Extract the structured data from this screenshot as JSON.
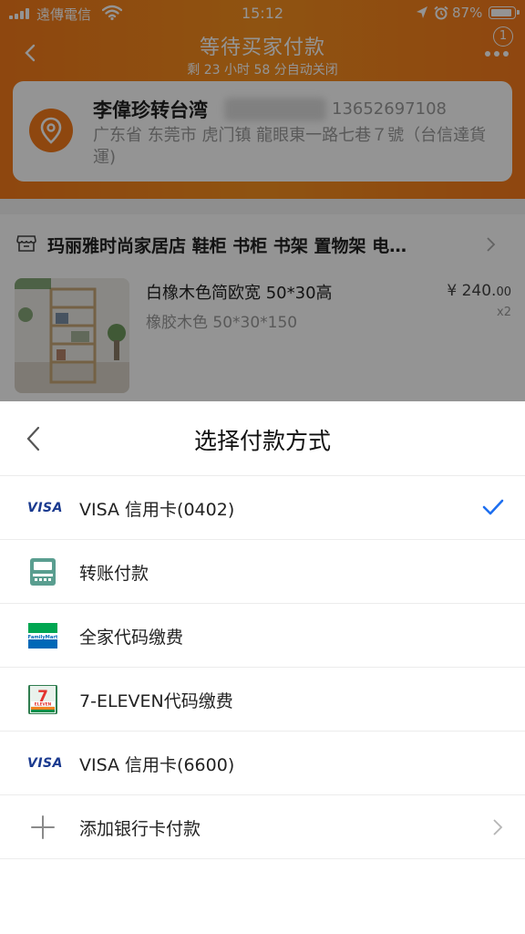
{
  "status_bar": {
    "carrier": "遠傳電信",
    "time": "15:12",
    "battery": "87%"
  },
  "header": {
    "title": "等待买家付款",
    "subtitle": "剩 23 小时 58 分自动关闭",
    "notification_count": "1"
  },
  "address": {
    "name": "李偉珍转台湾",
    "phone": "13652697108",
    "line": "广东省 东莞市 虎门镇 龍眼東一路七巷７號（台信達貨運)"
  },
  "store": {
    "name": "玛丽雅时尚家居店 鞋柜 书柜 书架 置物架 电…"
  },
  "product": {
    "title": "白橡木色简欧宽 50*30高",
    "spec": "橡胶木色 50*30*150",
    "price_main": "¥ 240.",
    "price_cents": "00",
    "quantity": "x2"
  },
  "payment_sheet": {
    "title": "选择付款方式",
    "methods": [
      {
        "label": "VISA 信用卡(0402)",
        "icon": "visa-icon",
        "selected": true
      },
      {
        "label": "转账付款",
        "icon": "atm-icon",
        "selected": false
      },
      {
        "label": "全家代码缴费",
        "icon": "familymart-icon",
        "selected": false
      },
      {
        "label": "7-ELEVEN代码缴费",
        "icon": "seven-eleven-icon",
        "selected": false
      },
      {
        "label": "VISA 信用卡(6600)",
        "icon": "visa-icon",
        "selected": false
      },
      {
        "label": "添加银行卡付款",
        "icon": "plus-icon",
        "selected": false
      }
    ],
    "visa_text": "VISA",
    "familymart_text": "FamilyMart",
    "seven_text": "ELEVEN",
    "seven_digit": "7"
  },
  "colors": {
    "header_orange": "#f47a1a",
    "check_blue": "#1e6ff0",
    "visa_blue": "#1a3a8f",
    "familymart_green": "#00a651",
    "familymart_blue": "#0068b7"
  }
}
